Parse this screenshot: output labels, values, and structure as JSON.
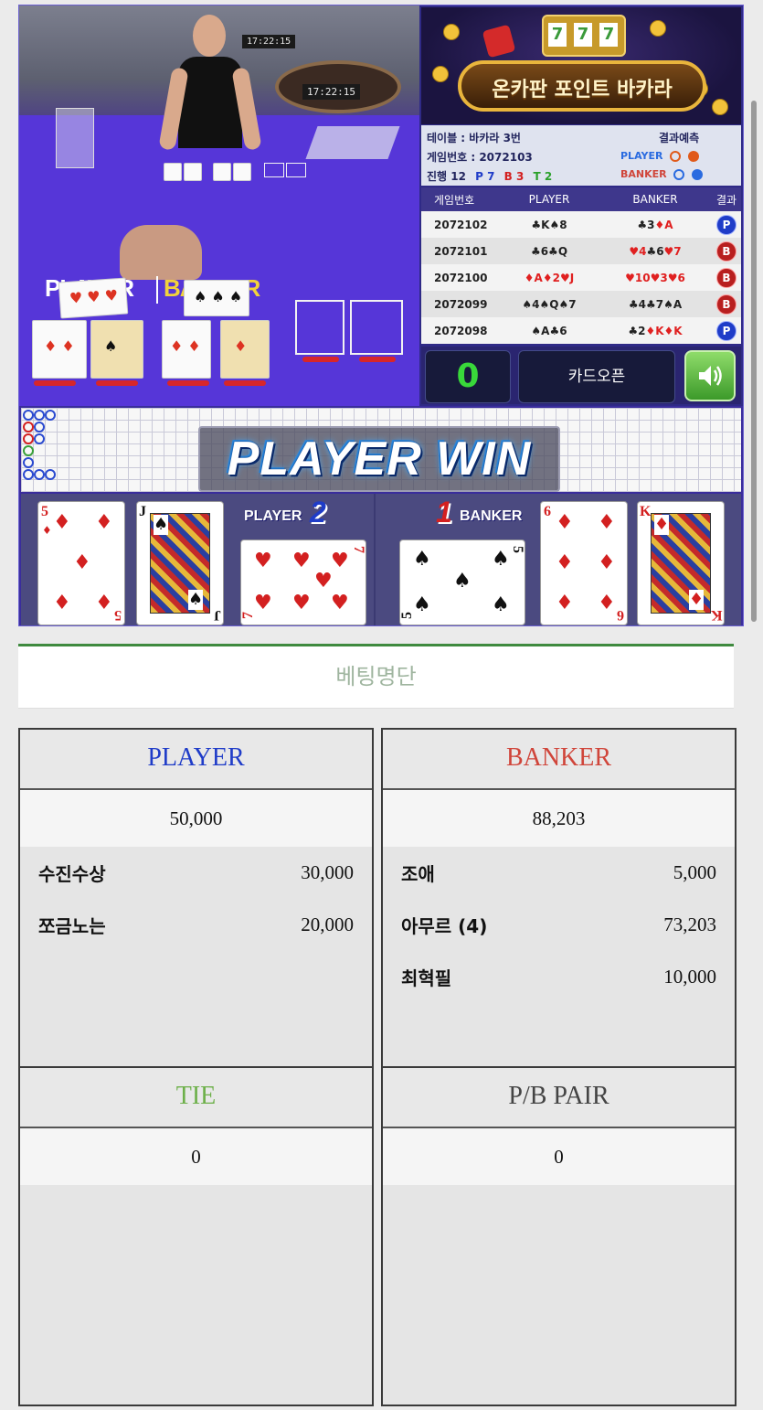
{
  "video": {
    "clock_main": "17:22:15",
    "clock_small": "17:22:15",
    "felt_player": "PLAYER",
    "felt_banker": "BANKER"
  },
  "banner": {
    "title": "온카판 포인트 바카라",
    "slot": [
      "7",
      "7",
      "7"
    ]
  },
  "status": {
    "table": "테이블 : 바카라 3번",
    "game_no": "게임번호 : 2072103",
    "progress_label": "진행 12",
    "p_count": "P 7",
    "b_count": "B 3",
    "t_count": "T 2",
    "predict_label": "결과예측",
    "predict_player": "PLAYER",
    "predict_banker": "BANKER",
    "colors": {
      "player": "#2a6be0",
      "banker": "#e05a1a"
    }
  },
  "history": {
    "headers": [
      "게임번호",
      "PLAYER",
      "BANKER",
      "결과"
    ],
    "rows": [
      {
        "no": "2072102",
        "player": "♣K♠8",
        "banker": "♣3♦A",
        "result": "P"
      },
      {
        "no": "2072101",
        "player": "♣6♣Q",
        "banker": "♥4♣6♥7",
        "result": "B"
      },
      {
        "no": "2072100",
        "player": "♦A♦2♥J",
        "banker": "♥10♥3♥6",
        "result": "B"
      },
      {
        "no": "2072099",
        "player": "♠4♠Q♠7",
        "banker": "♣4♣7♠A",
        "result": "B"
      },
      {
        "no": "2072098",
        "player": "♠A♣6",
        "banker": "♣2♦K♦K",
        "result": "P"
      }
    ]
  },
  "controls": {
    "count": "0",
    "open_label": "카드오픈",
    "sound_icon": "speaker-icon"
  },
  "win_text": "PLAYER WIN",
  "cards": {
    "player_label": "PLAYER",
    "player_score": "2",
    "banker_label": "BANKER",
    "banker_score": "1",
    "player_cards": [
      {
        "rank": "5",
        "suit": "♦"
      },
      {
        "rank": "J",
        "suit": "♠"
      },
      {
        "rank": "7",
        "suit": "♥"
      }
    ],
    "banker_cards": [
      {
        "rank": "5",
        "suit": "♠"
      },
      {
        "rank": "6",
        "suit": "♦"
      },
      {
        "rank": "K",
        "suit": "♦"
      }
    ]
  },
  "bet_list_title": "베팅명단",
  "panels": {
    "player": {
      "title": "PLAYER",
      "title_color": "#1f3cc8",
      "total": "50,000",
      "rows": [
        {
          "name": "수진수상",
          "amount": "30,000"
        },
        {
          "name": "쪼금노는",
          "amount": "20,000"
        }
      ]
    },
    "banker": {
      "title": "BANKER",
      "title_color": "#d0453a",
      "total": "88,203",
      "rows": [
        {
          "name": "조애",
          "amount": "5,000"
        },
        {
          "name": "아무르 (4)",
          "amount": "73,203"
        },
        {
          "name": "최혁필",
          "amount": "10,000"
        }
      ]
    },
    "tie": {
      "title": "TIE",
      "title_color": "#6db04a",
      "total": "0"
    },
    "pair": {
      "title": "P/B PAIR",
      "title_color": "#444444",
      "total": "0"
    }
  }
}
